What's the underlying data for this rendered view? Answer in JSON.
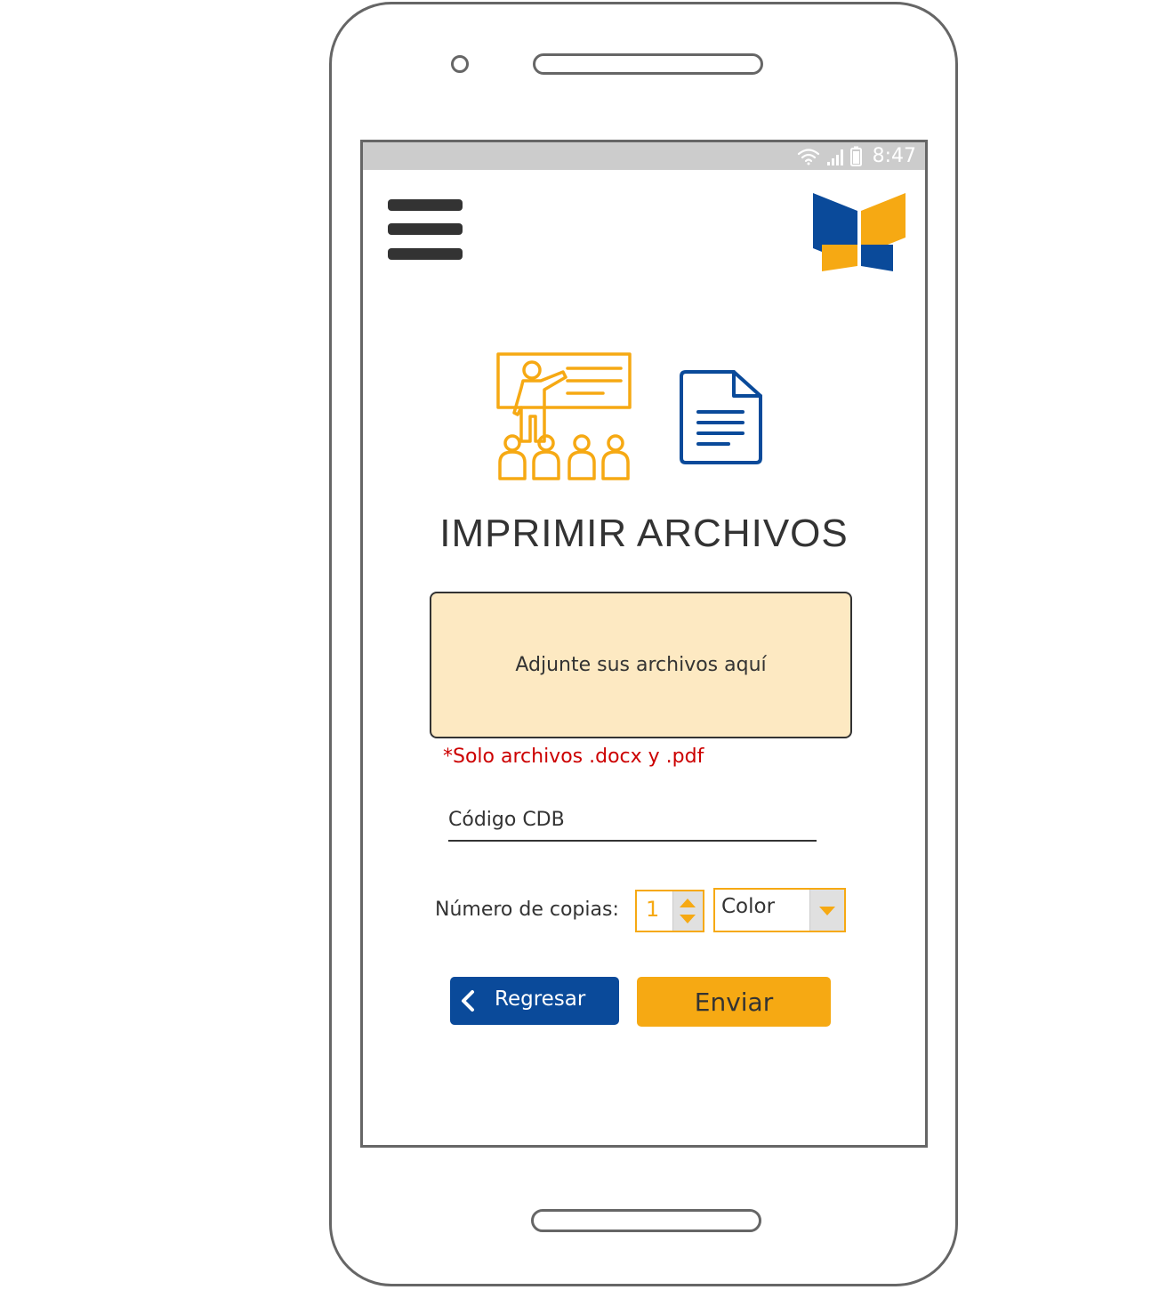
{
  "status_bar": {
    "time": "8:47",
    "icons": [
      "wifi-icon",
      "signal-icon",
      "battery-icon"
    ]
  },
  "header": {
    "menu_icon": "hamburger-icon",
    "logo": "book-logo"
  },
  "page": {
    "title": "IMPRIMIR ARCHIVOS"
  },
  "upload": {
    "dropzone_label": "Adjunte sus archivos aquí",
    "note": "*Solo archivos .docx y .pdf"
  },
  "form": {
    "code_placeholder": "Código CDB",
    "copies_label": "Número de copias:",
    "copies_value": "1",
    "color_mode": "Color"
  },
  "actions": {
    "back_label": "Regresar",
    "send_label": "Enviar"
  },
  "colors": {
    "accent": "#f6a913",
    "brand_blue": "#0a4a9a",
    "dropzone_bg": "#fde9c2",
    "note_red": "#cc0000"
  }
}
